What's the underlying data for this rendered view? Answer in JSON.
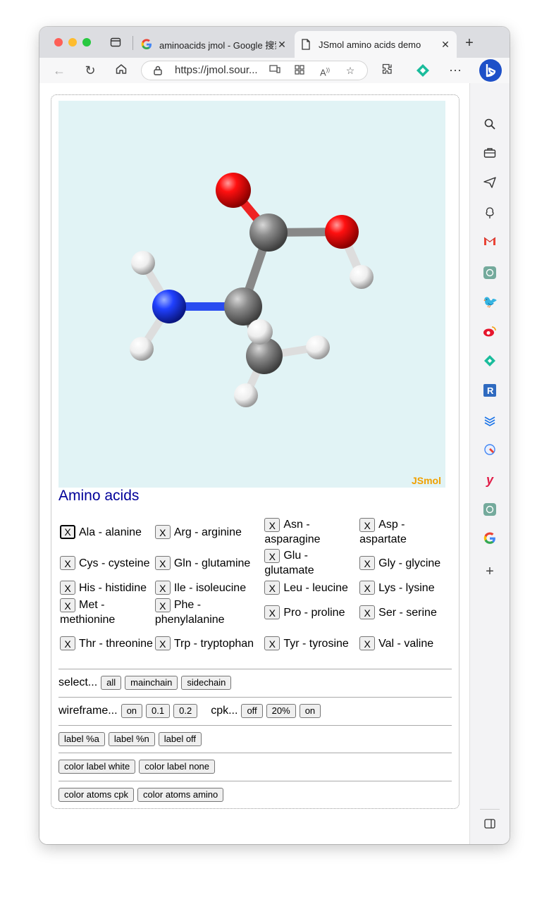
{
  "browser": {
    "tabs": [
      {
        "title": "aminoacids jmol - Google 搜索",
        "favicon": "google-icon"
      },
      {
        "title": "JSmol amino acids demo",
        "favicon": "page-icon"
      }
    ],
    "url": "https://jmol.sour..."
  },
  "viewer": {
    "logo": "JSmol"
  },
  "page": {
    "title": "Amino acids"
  },
  "amino_acids": {
    "button_label": "X",
    "rows": [
      [
        "Ala - alanine",
        "Arg - arginine",
        "Asn - asparagine",
        "Asp - aspartate"
      ],
      [
        "Cys - cysteine",
        "Gln - glutamine",
        "Glu - glutamate",
        "Gly - glycine"
      ],
      [
        "His - histidine",
        "Ile - isoleucine",
        "Leu - leucine",
        "Lys - lysine"
      ],
      [
        "Met - methionine",
        "Phe - phenylalanine",
        "Pro - proline",
        "Ser - serine"
      ],
      [
        "Thr - threonine",
        "Trp - tryptophan",
        "Tyr - tyrosine",
        "Val - valine"
      ]
    ]
  },
  "controls": {
    "select": {
      "label": "select...",
      "buttons": [
        "all",
        "mainchain",
        "sidechain"
      ]
    },
    "wireframe": {
      "label": "wireframe...",
      "buttons": [
        "on",
        "0.1",
        "0.2"
      ]
    },
    "cpk": {
      "label": "cpk...",
      "buttons": [
        "off",
        "20%",
        "on"
      ]
    },
    "labels": {
      "buttons": [
        "label %a",
        "label %n",
        "label off"
      ]
    },
    "label_colors": {
      "buttons": [
        "color label white",
        "color label none"
      ]
    },
    "atom_colors": {
      "buttons": [
        "color atoms cpk",
        "color atoms amino"
      ]
    }
  },
  "colors": {
    "oxygen": "#e00000",
    "carbon": "#8a8a8a",
    "nitrogen": "#1e3cf0",
    "hydrogen": "#ffffff",
    "viewer_bg": "#e1f3f5",
    "title": "#000099",
    "jsmol_logo": "#f0a000"
  }
}
